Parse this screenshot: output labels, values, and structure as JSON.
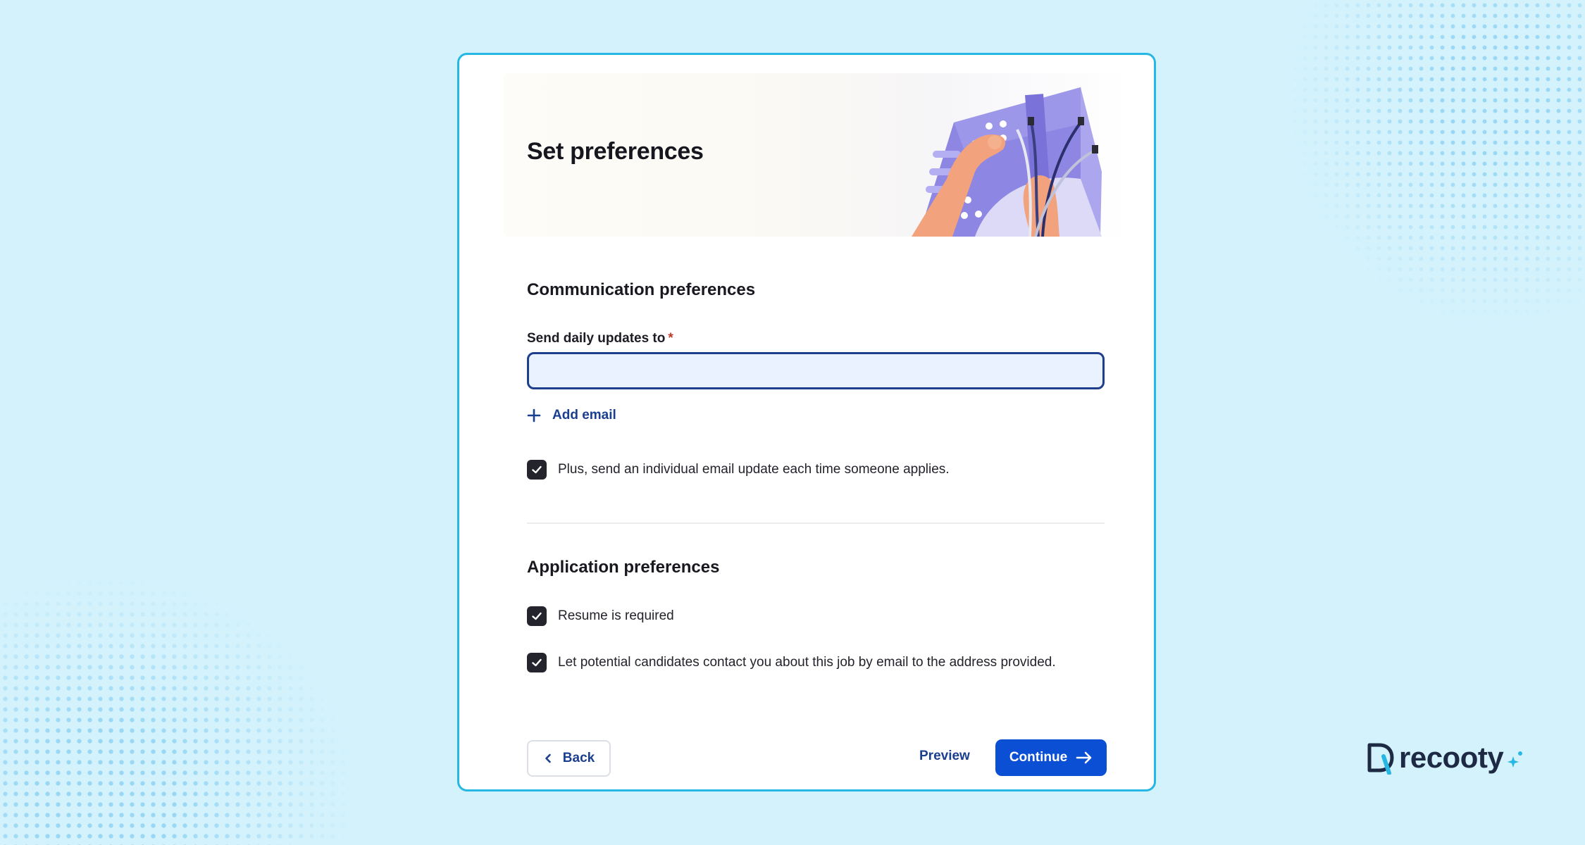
{
  "hero": {
    "title": "Set preferences"
  },
  "communication": {
    "title": "Communication preferences",
    "field_label": "Send daily updates to",
    "required_mark": "*",
    "email_value": "",
    "add_email_label": "Add email",
    "individual_update_label": "Plus, send an individual email update each time someone applies.",
    "individual_update_checked": true
  },
  "application": {
    "title": "Application preferences",
    "resume_label": "Resume is required",
    "resume_checked": true,
    "contact_label": "Let potential candidates contact you about this job by email to the address provided.",
    "contact_checked": true
  },
  "footer": {
    "back_label": "Back",
    "preview_label": "Preview",
    "continue_label": "Continue"
  },
  "brand": {
    "name": "recooty"
  },
  "colors": {
    "background": "#d4f2fc",
    "card_border": "#27b7e4",
    "accent": "#0a4fd4",
    "link": "#1b3f8f",
    "checkbox": "#24242c",
    "input_fill": "#e9f2fe"
  },
  "icons": {
    "add": "plus-icon",
    "check": "check-icon",
    "back": "chevron-left-icon",
    "continue": "arrow-right-icon",
    "brand": "recooty-logo-icon"
  }
}
